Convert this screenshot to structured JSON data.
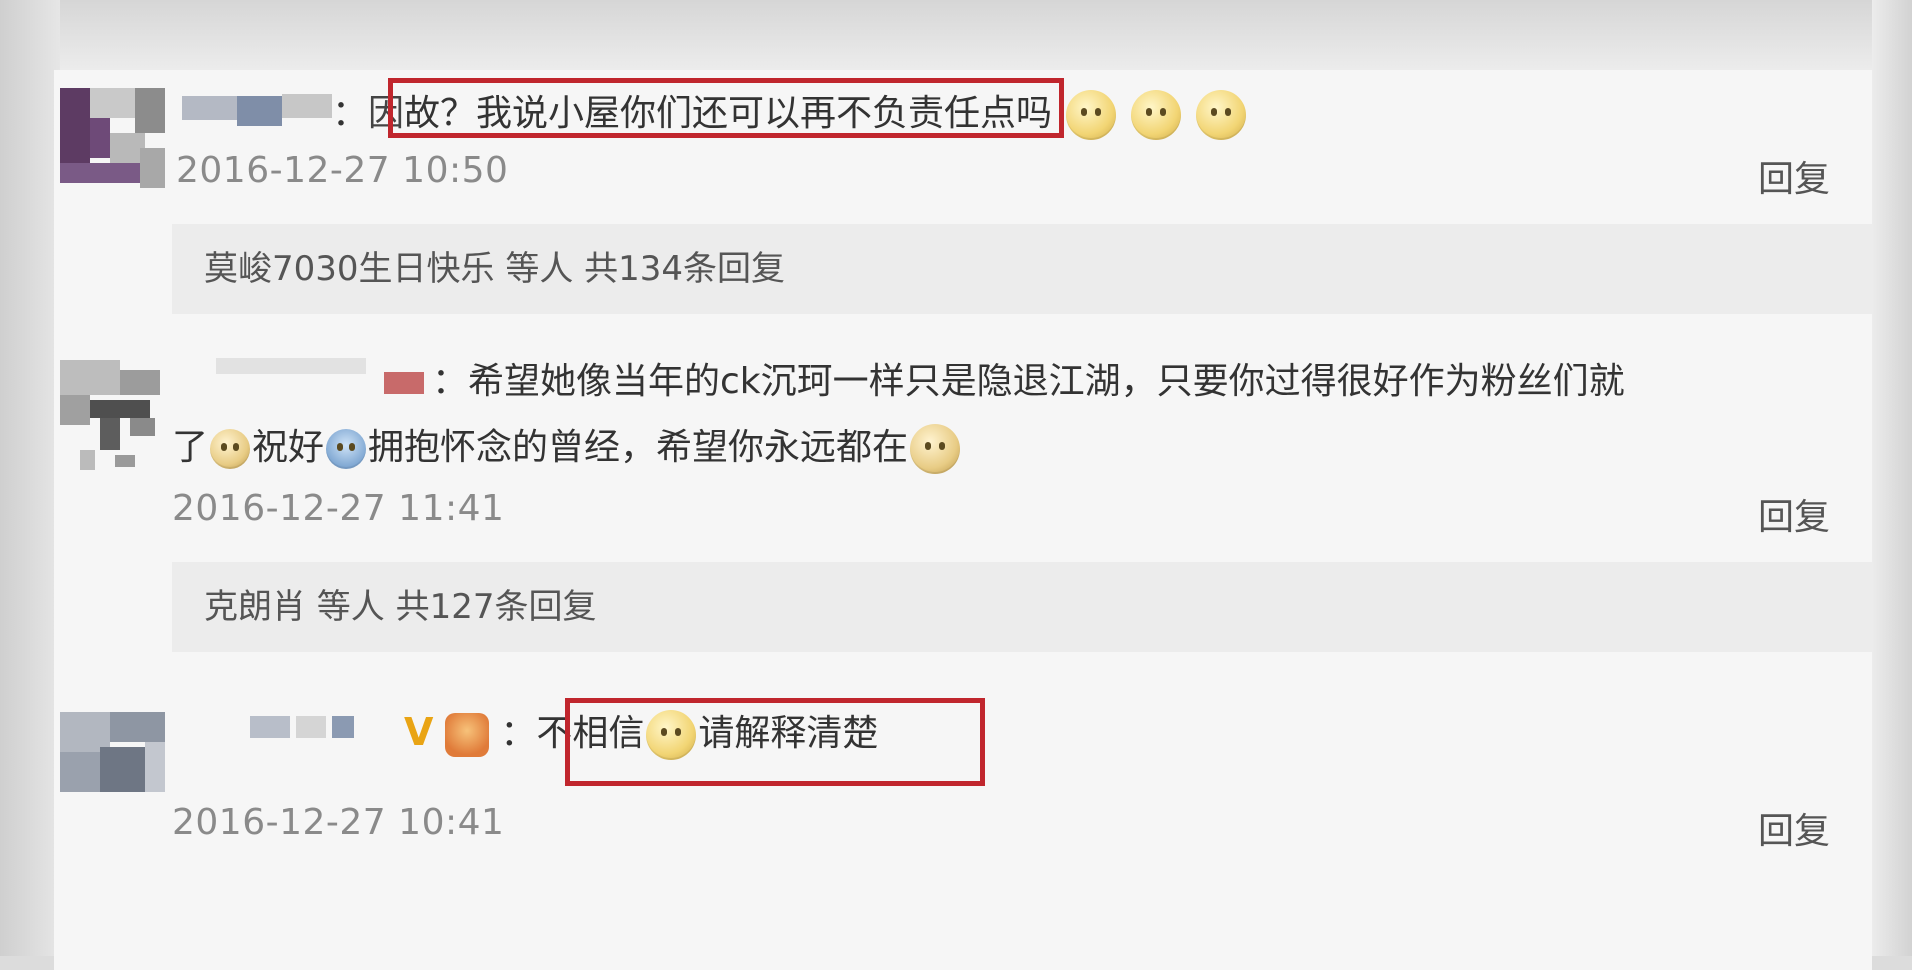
{
  "comments": [
    {
      "text_prefix": "：",
      "text_start": "",
      "text": "故？我说小屋你们还可以再不负责任点吗",
      "timestamp": "2016-12-27 10:50",
      "reply_label": "回复",
      "reply_summary": "莫峻7030生日快乐 等人 共134条回复"
    },
    {
      "text_line1": "：希望她像当年的ck沉珂一样只是隐退江湖，只要你过得很好作为粉丝们就",
      "text_line2_a": "了",
      "text_line2_b": "祝好",
      "text_line2_c": "拥抱怀念的曾经，希望你永远都在",
      "timestamp": "2016-12-27 11:41",
      "reply_label": "回复",
      "reply_summary": "克朗肖 等人 共127条回复"
    },
    {
      "vip_mark": "V",
      "text_prefix": "：",
      "text_a": "不相信",
      "text_b": "请解释清楚",
      "timestamp": "2016-12-27 10:41",
      "reply_label": "回复"
    }
  ],
  "colors": {
    "highlight": "#c0262d",
    "timestamp": "#8a8a8a",
    "background": "#f6f6f6"
  },
  "icons": [
    "smiley-emoji",
    "sad-emoji",
    "hug-emoji",
    "vip-icon",
    "badge-icon"
  ]
}
